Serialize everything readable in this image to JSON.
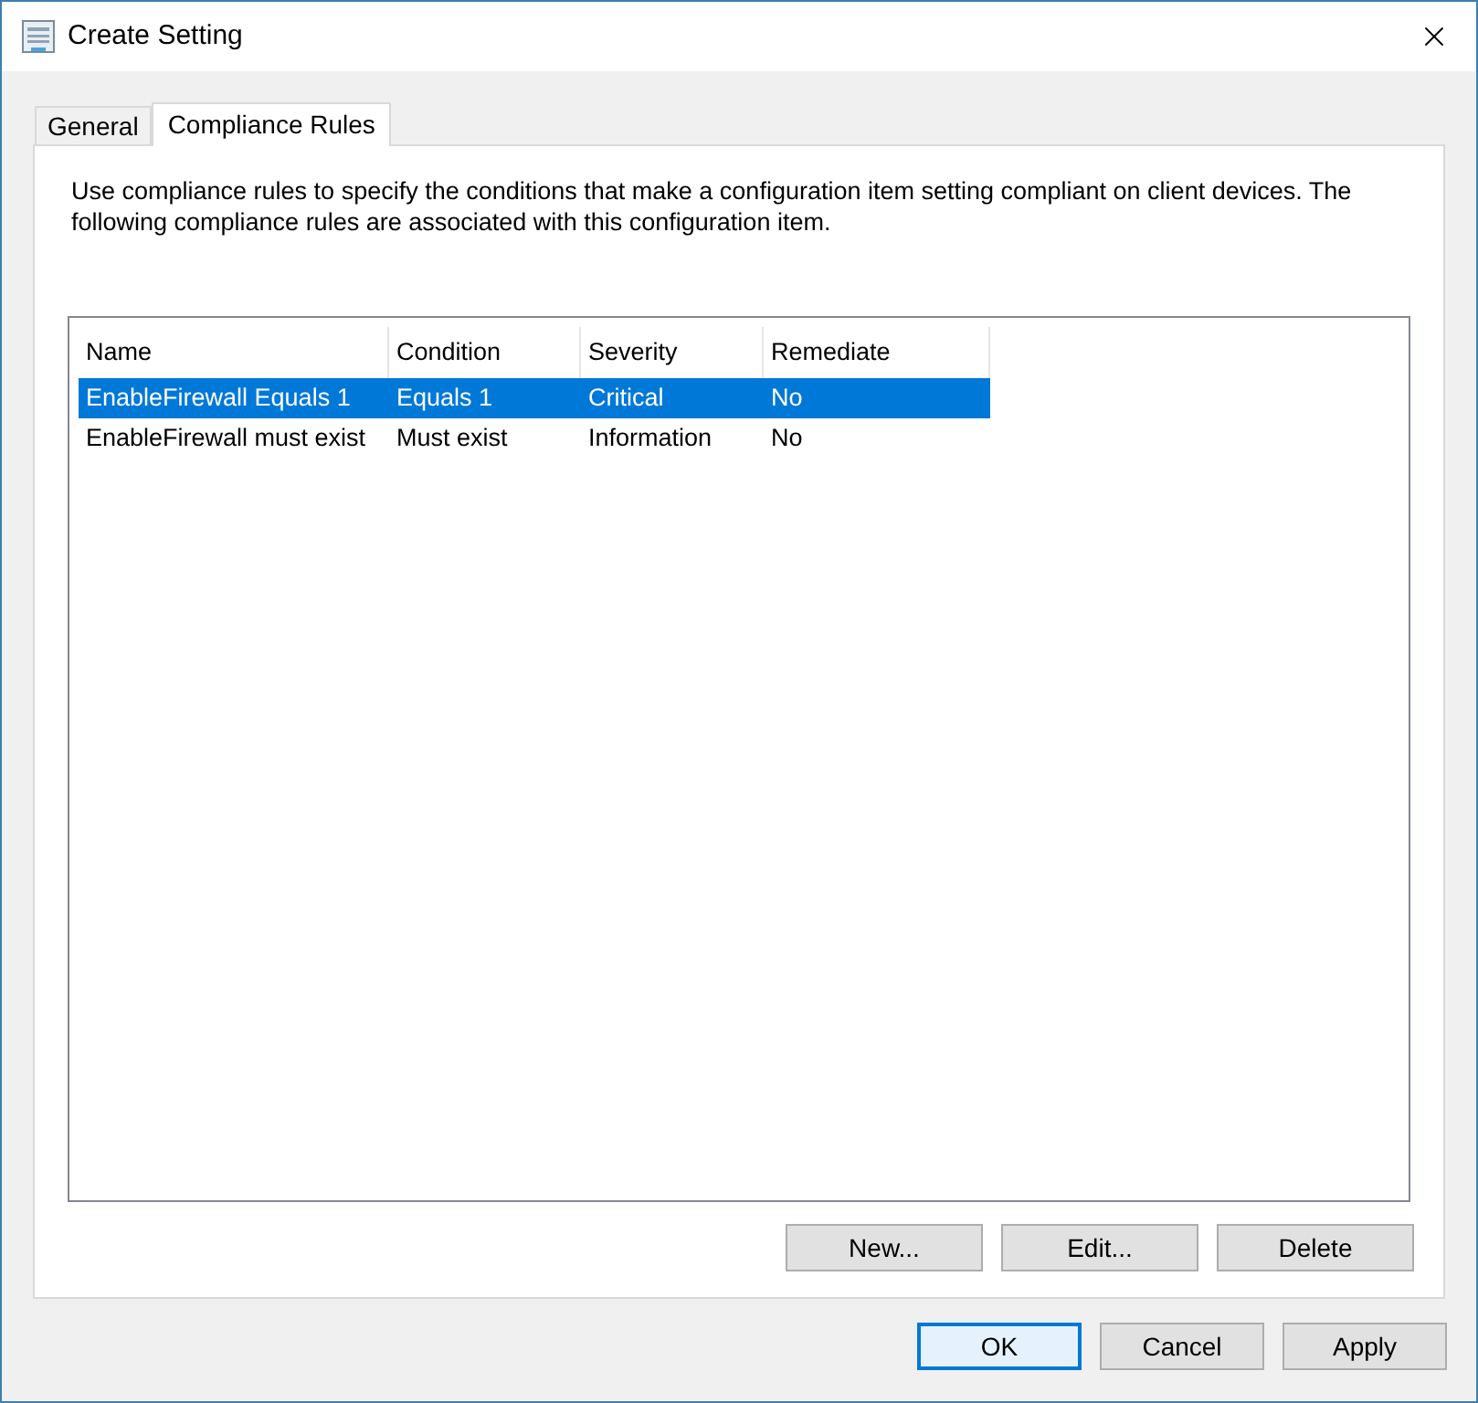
{
  "window": {
    "title": "Create Setting"
  },
  "tabs": [
    {
      "label": "General",
      "selected": false
    },
    {
      "label": "Compliance Rules",
      "selected": true
    }
  ],
  "description": "Use compliance rules to specify the conditions that make a configuration item setting compliant on client devices. The following compliance rules are associated with this configuration item.",
  "table": {
    "columns": [
      "Name",
      "Condition",
      "Severity",
      "Remediate"
    ],
    "rows": [
      {
        "cells": [
          "EnableFirewall Equals 1",
          "Equals 1",
          "Critical",
          "No"
        ],
        "selected": true
      },
      {
        "cells": [
          "EnableFirewall must exist",
          "Must exist",
          "Information",
          "No"
        ],
        "selected": false
      }
    ]
  },
  "rule_buttons": [
    "New...",
    "Edit...",
    "Delete"
  ],
  "dialog_buttons": [
    {
      "label": "OK",
      "default": true
    },
    {
      "label": "Cancel",
      "default": false
    },
    {
      "label": "Apply",
      "default": false
    }
  ]
}
